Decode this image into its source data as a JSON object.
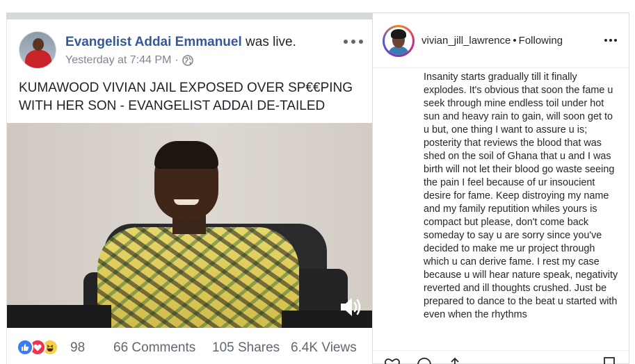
{
  "facebook_post": {
    "author": "Evangelist Addai Emmanuel",
    "action": " was live.",
    "timestamp": "Yesterday at 7:44 PM",
    "separator": "·",
    "privacy_icon": "globe-icon",
    "headline": "KUMAWOOD VIVIAN JAIL EXPOSED OVER SP€€PING WITH HER SON - EVANGELIST ADDAI DE-TAILED",
    "video_icon": "volume-icon",
    "reactions": [
      "like",
      "love",
      "haha"
    ],
    "reaction_count": "98",
    "comments": "66 Comments",
    "shares": "105 Shares",
    "views": "6.4K Views"
  },
  "instagram_post": {
    "username": "vivian_jill_lawrence",
    "separator": "•",
    "follow_state": "Following",
    "caption": "Insanity starts gradually till it finally explodes. It's obvious that soon the fame u seek through mine endless toil under hot sun and heavy rain to gain, will soon get to u but, one thing I want to assure u is; posterity that reviews the blood that was shed on the soil of Ghana that u and I was birth will not let their blood go waste seeing the pain I feel because of ur insoucient desire for fame. Keep distroying my name and my family reputition whiles yours is compact but please, don't come back someday to say u are sorry since you've decided to make me ur project through which u can derive fame. I rest my case because u will hear nature speak, negativity reverted and ill thoughts crushed. Just be prepared to dance to the beat u started with even when the rhythms",
    "action_icons": [
      "heart-icon",
      "comment-icon",
      "share-icon",
      "bookmark-icon"
    ]
  },
  "colors": {
    "fb_link": "#365899",
    "fb_meta": "#7f8591",
    "text": "#1d2129",
    "ig_text": "#262626"
  }
}
